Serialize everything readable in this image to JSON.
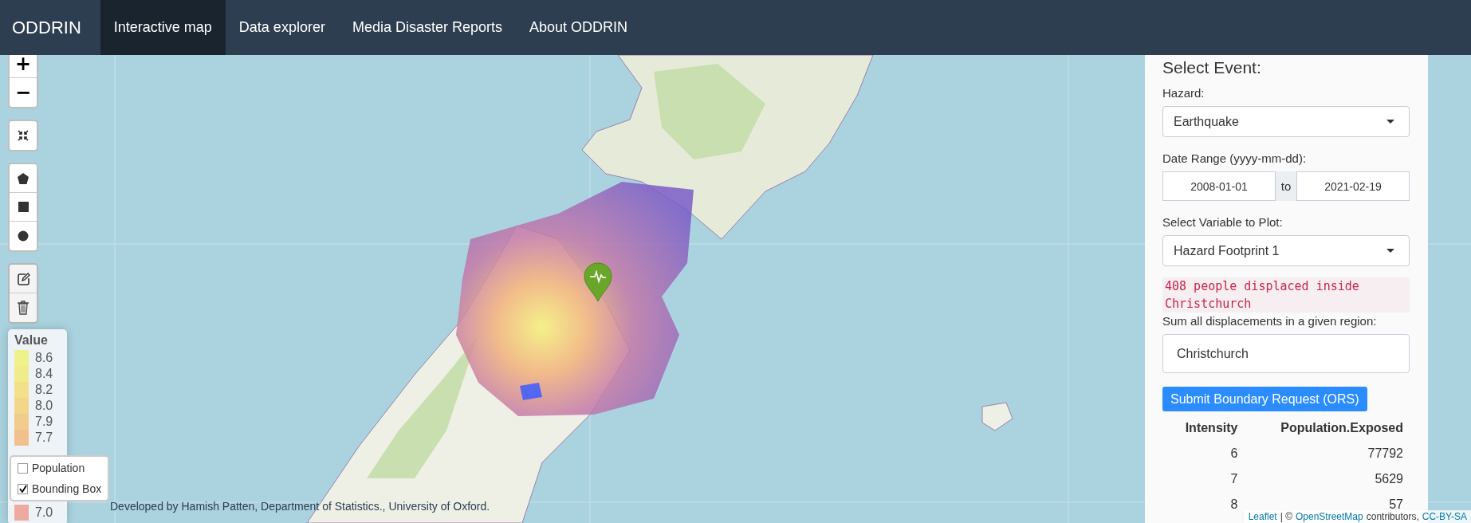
{
  "navbar": {
    "brand": "ODDRIN",
    "tabs": [
      {
        "label": "Interactive map",
        "selected": true
      },
      {
        "label": "Data explorer",
        "selected": false
      },
      {
        "label": "Media Disaster Reports",
        "selected": false
      },
      {
        "label": "About ODDRIN",
        "selected": false
      }
    ]
  },
  "map_controls": {
    "zoom_in": "+",
    "zoom_out": "−"
  },
  "legend": {
    "title": "Value",
    "items": [
      {
        "label": "8.6",
        "color": "#eef28a"
      },
      {
        "label": "8.4",
        "color": "#f0ec8c"
      },
      {
        "label": "8.2",
        "color": "#f2e08a"
      },
      {
        "label": "8.0",
        "color": "#f3d68a"
      },
      {
        "label": "7.9",
        "color": "#f2cc8c"
      },
      {
        "label": "7.7",
        "color": "#f2c08c"
      },
      {
        "label": "7.0",
        "color": "#eeaaa0"
      }
    ]
  },
  "layers": [
    {
      "label": "Population",
      "checked": false
    },
    {
      "label": "Bounding Box",
      "checked": true
    }
  ],
  "credit": "Developed by Hamish Patten, Department of Statistics., University of Oxford.",
  "panel": {
    "title": "Select Event:",
    "hazard": {
      "label": "Hazard:",
      "value": "Earthquake"
    },
    "date_range": {
      "label": "Date Range (yyyy-mm-dd):",
      "start": "2008-01-01",
      "separator": "to",
      "end": "2021-02-19"
    },
    "variable": {
      "label": "Select Variable to Plot:",
      "value": "Hazard Footprint 1"
    },
    "result": "408 people displaced inside Christchurch",
    "region": {
      "label": "Sum all displacements in a given region:",
      "value": "Christchurch"
    },
    "submit": "Submit Boundary Request (ORS)",
    "table": {
      "columns": [
        "Intensity",
        "Population.Exposed"
      ],
      "rows": [
        [
          "6",
          "77792"
        ],
        [
          "7",
          "5629"
        ],
        [
          "8",
          "57"
        ]
      ]
    }
  },
  "attribution": [
    {
      "kind": "link",
      "text": "Leaflet"
    },
    {
      "kind": "text",
      "text": "| ©"
    },
    {
      "kind": "link",
      "text": "OpenStreetMap"
    },
    {
      "kind": "text",
      "text": "contributors,"
    },
    {
      "kind": "link",
      "text": "CC-BY-SA"
    }
  ]
}
